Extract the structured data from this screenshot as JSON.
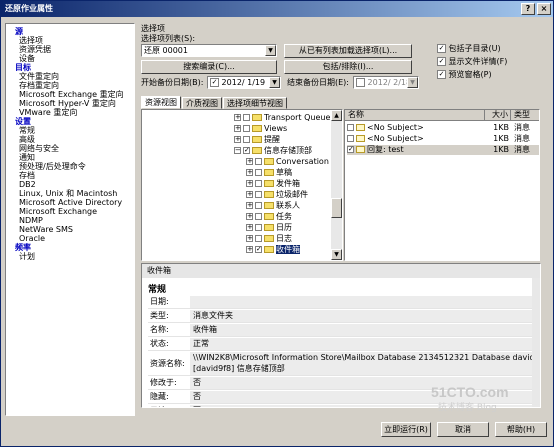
{
  "window": {
    "title": "还原作业属性",
    "help_btn": "?",
    "close_btn": "×"
  },
  "sidebar": [
    {
      "type": "section",
      "label": "源"
    },
    {
      "type": "item",
      "label": "选择项"
    },
    {
      "type": "item",
      "label": "资源凭据"
    },
    {
      "type": "item",
      "label": "设备"
    },
    {
      "type": "section",
      "label": "目标"
    },
    {
      "type": "item",
      "label": "文件重定向"
    },
    {
      "type": "item",
      "label": "存档重定向"
    },
    {
      "type": "item",
      "label": "Microsoft Exchange 重定向"
    },
    {
      "type": "item",
      "label": "Microsoft Hyper-V 重定向"
    },
    {
      "type": "item",
      "label": "VMware 重定向"
    },
    {
      "type": "section",
      "label": "设置"
    },
    {
      "type": "item",
      "label": "常规"
    },
    {
      "type": "item",
      "label": "高级"
    },
    {
      "type": "item",
      "label": "网络与安全"
    },
    {
      "type": "item",
      "label": "通知"
    },
    {
      "type": "item",
      "label": "预处理/后处理命令"
    },
    {
      "type": "item",
      "label": "存档"
    },
    {
      "type": "item",
      "label": "DB2"
    },
    {
      "type": "item",
      "label": "Linux, Unix 和 Macintosh"
    },
    {
      "type": "item",
      "label": "Microsoft Active Directory"
    },
    {
      "type": "item",
      "label": "Microsoft Exchange"
    },
    {
      "type": "item",
      "label": "NDMP"
    },
    {
      "type": "item",
      "label": "NetWare SMS"
    },
    {
      "type": "item",
      "label": "Oracle"
    },
    {
      "type": "section",
      "label": "频率"
    },
    {
      "type": "item",
      "label": "计划"
    }
  ],
  "selection": {
    "group_label": "选择项",
    "list_label": "选择项列表(S):",
    "list_value": "还原 00001",
    "load_btn": "从已有列表加载选择项(L)...",
    "search_btn": "搜索编录(C)...",
    "include_btn": "包括/排除(I)...",
    "start_label": "开始备份日期(B):",
    "start_value": "2012/ 1/19",
    "end_label": "结束备份日期(E):",
    "end_value": "2012/ 2/18",
    "opt_subdir": "包括子目录(U)",
    "opt_details": "显示文件详情(F)",
    "opt_preview": "预览窗格(P)"
  },
  "tabs": [
    "资源视图",
    "介质视图",
    "选择项细节视图"
  ],
  "tree": [
    {
      "label": "Transport Queue",
      "indent": 0,
      "checked": false
    },
    {
      "label": "Views",
      "indent": 0,
      "checked": false
    },
    {
      "label": "提醒",
      "indent": 0,
      "checked": false
    },
    {
      "label": "信息存储顶部",
      "indent": 0,
      "checked": true,
      "expanded": true
    },
    {
      "label": "Conversation",
      "indent": 1,
      "checked": false
    },
    {
      "label": "草稿",
      "indent": 1,
      "checked": false
    },
    {
      "label": "发件箱",
      "indent": 1,
      "checked": false
    },
    {
      "label": "垃圾邮件",
      "indent": 1,
      "checked": false
    },
    {
      "label": "联系人",
      "indent": 1,
      "checked": false
    },
    {
      "label": "任务",
      "indent": 1,
      "checked": false
    },
    {
      "label": "日历",
      "indent": 1,
      "checked": false
    },
    {
      "label": "日志",
      "indent": 1,
      "checked": false
    },
    {
      "label": "收件箱",
      "indent": 1,
      "checked": true,
      "selected": true
    }
  ],
  "list": {
    "columns": [
      "名称",
      "大小",
      "类型"
    ],
    "rows": [
      {
        "name": "<No Subject>",
        "size": "1KB",
        "type": "消息",
        "checked": false
      },
      {
        "name": "<No Subject>",
        "size": "1KB",
        "type": "消息",
        "checked": false
      },
      {
        "name": "回复: test",
        "size": "1KB",
        "type": "消息",
        "checked": true
      }
    ]
  },
  "preview": {
    "header": "收件箱",
    "section": "常规",
    "rows": [
      {
        "key": "日期:",
        "value": ""
      },
      {
        "key": "类型:",
        "value": "消息文件夹"
      },
      {
        "key": "名称:",
        "value": "收件箱"
      },
      {
        "key": "状态:",
        "value": "正常"
      },
      {
        "key": "资源名称:",
        "value": "\\\\WIN2K8\\Microsoft Information Store\\Mailbox Database 2134512321    Database    david [david9f8]  信息存储顶部"
      },
      {
        "key": "修改于:",
        "value": "否"
      },
      {
        "key": "隐藏:",
        "value": "否"
      },
      {
        "key": "只读:",
        "value": "否"
      }
    ]
  },
  "footer": {
    "run_btn": "立即运行(R)",
    "cancel_btn": "取消",
    "help_btn": "帮助(H)"
  },
  "watermark": {
    "line1": "51CTO.com",
    "line2": "技术博客  Blog"
  }
}
